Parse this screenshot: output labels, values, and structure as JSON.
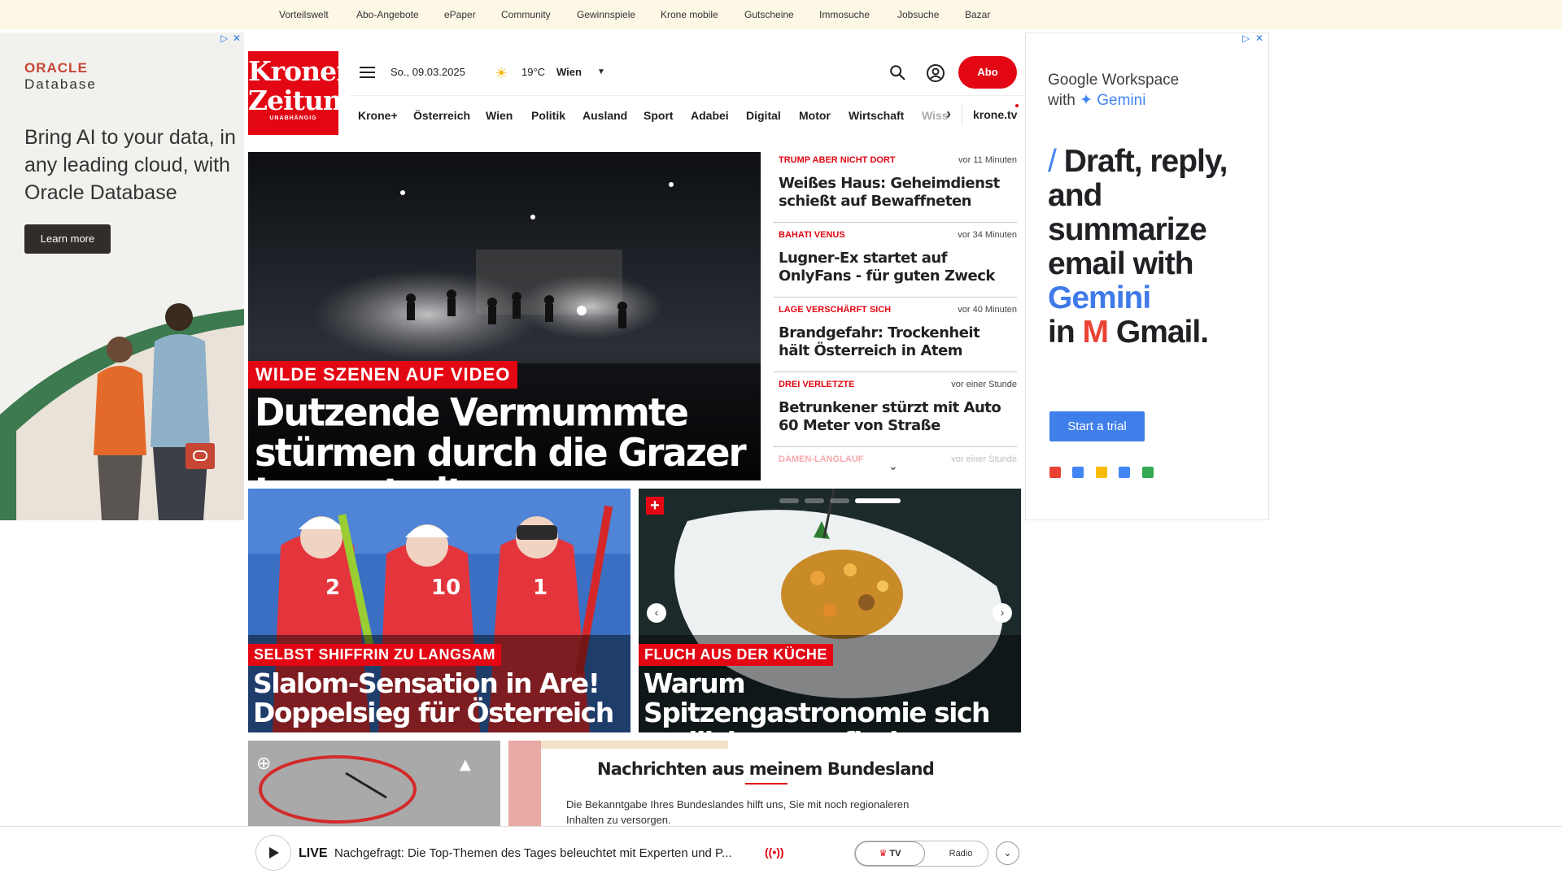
{
  "topnav": [
    "Vorteilswelt",
    "Abo-Angebote",
    "ePaper",
    "Community",
    "Gewinnspiele",
    "Krone mobile",
    "Gutscheine",
    "Immosuche",
    "Jobsuche",
    "Bazar"
  ],
  "ad_left": {
    "brand": "ORACLE",
    "brand_sub": "Database",
    "text": "Bring AI to your data, in any leading cloud, with Oracle Database",
    "button": "Learn more"
  },
  "logo": {
    "line1": "Kronen",
    "line2": "Zeitung",
    "line3": "UNABHÄNGIG"
  },
  "header": {
    "date": "So., 09.03.2025",
    "temp": "19°C",
    "city": "Wien",
    "abo": "Abo",
    "kronetv": "krone.tv"
  },
  "nav": [
    "Krone+",
    "Österreich",
    "Wien",
    "Politik",
    "Ausland",
    "Sport",
    "Adabei",
    "Digital",
    "Motor",
    "Wirtschaft",
    "Wiss"
  ],
  "hero": {
    "kicker": "WILDE SZENEN AUF VIDEO",
    "title": "Dutzende Vermummte stürmen durch die Grazer Innenstadt"
  },
  "newslist": [
    {
      "kicker": "TRUMP ABER NICHT DORT",
      "time": "vor 11 Minuten",
      "title": "Weißes Haus: Geheimdienst schießt auf Bewaffneten"
    },
    {
      "kicker": "BAHATI VENUS",
      "time": "vor 34 Minuten",
      "title": "Lugner-Ex startet auf OnlyFans - für guten Zweck"
    },
    {
      "kicker": "LAGE VERSCHÄRFT SICH",
      "time": "vor 40 Minuten",
      "title": "Brandgefahr: Trockenheit hält Österreich in Atem"
    },
    {
      "kicker": "DREI VERLETZTE",
      "time": "vor einer Stunde",
      "title": "Betrunkener stürzt mit Auto 60 Meter von Straße"
    },
    {
      "kicker": "DAMEN-LANGLAUF",
      "time": "vor einer Stunde",
      "title": ""
    }
  ],
  "card1": {
    "kicker": "SELBST SHIFFRIN ZU LANGSAM",
    "title": "Slalom-Sensation in Are! Doppelsieg für Österreich"
  },
  "card2": {
    "kicker": "FLUCH AUS DER KÜCHE",
    "title": "Warum Spitzengastronomie sich endlich neu erfinden muss"
  },
  "bundesland": {
    "title": "Nachrichten aus meinem Bundesland",
    "text": "Die Bekanntgabe Ihres Bundeslandes hilft uns, Sie mit noch regionaleren Inhalten zu versorgen."
  },
  "live": {
    "label": "LIVE",
    "text": "Nachgefragt: Die Top-Themen des Tages beleuchtet mit Experten und P...",
    "tv": "TV",
    "radio": "Radio"
  },
  "ad_right": {
    "title_a": "Google Workspace",
    "title_b": "with",
    "title_c": "Gemini",
    "big_a": "Draft, reply, and summarize email with",
    "big_b": "Gemini",
    "big_c": "in",
    "big_d": "Gmail.",
    "button": "Start a trial"
  },
  "colors": {
    "brand_red": "#e30613",
    "topbar_bg": "#fdf7e6",
    "google_blue": "#3f7fe9"
  }
}
